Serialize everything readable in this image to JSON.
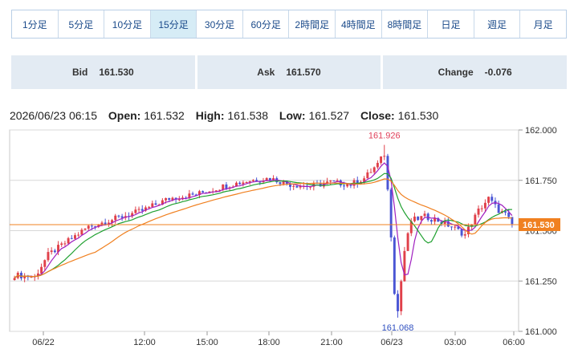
{
  "tabs": [
    {
      "label": "1分足"
    },
    {
      "label": "5分足"
    },
    {
      "label": "10分足"
    },
    {
      "label": "15分足",
      "active": true
    },
    {
      "label": "30分足"
    },
    {
      "label": "60分足"
    },
    {
      "label": "2時間足"
    },
    {
      "label": "4時間足"
    },
    {
      "label": "8時間足"
    },
    {
      "label": "日足"
    },
    {
      "label": "週足"
    },
    {
      "label": "月足"
    }
  ],
  "quotes": {
    "bid": {
      "label": "Bid",
      "value": "161.530"
    },
    "ask": {
      "label": "Ask",
      "value": "161.570"
    },
    "change": {
      "label": "Change",
      "value": "-0.076"
    }
  },
  "ohlc": {
    "datetime": "2026/06/23 06:15",
    "open_label": "Open:",
    "open": "161.532",
    "high_label": "High:",
    "high": "161.538",
    "low_label": "Low:",
    "low": "161.527",
    "close_label": "Close:",
    "close": "161.530"
  },
  "chart_data": {
    "type": "candlestick",
    "ylim": [
      161.0,
      162.0
    ],
    "y_ticks": [
      "162.000",
      "161.750",
      "161.500",
      "161.250",
      "161.000"
    ],
    "x_ticks": [
      "06/22",
      "12:00",
      "15:00",
      "18:00",
      "21:00",
      "06/23",
      "03:00",
      "06:00"
    ],
    "current_price": "161.530",
    "high_marker": "161.926",
    "low_marker": "161.068",
    "colors": {
      "up": "#e0404a",
      "down": "#4a55d4",
      "ma_short": "#a020c0",
      "ma_mid": "#20a030",
      "ma_long": "#f08020",
      "price_line": "#f08020",
      "high_marker": "#e0405a",
      "low_marker": "#3050c0"
    }
  }
}
